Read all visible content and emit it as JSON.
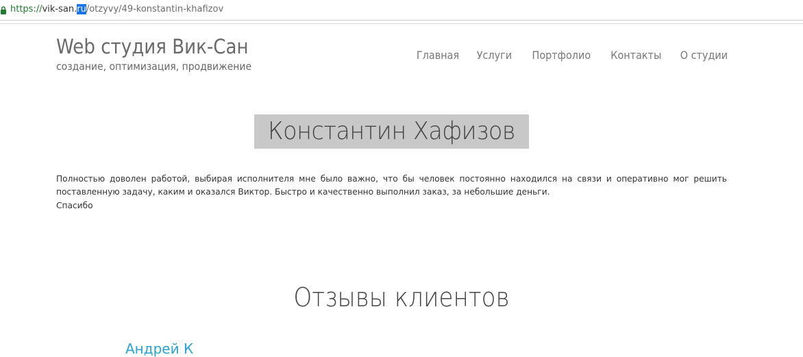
{
  "browser": {
    "url_protocol": "https://",
    "url_host_start": "vik-san.",
    "url_host_selected": "ru",
    "url_path": "/otzyvy/49-konstantin-khafizov"
  },
  "site": {
    "brand_title": "Web студия Вик-Сан",
    "brand_subtitle": "создание, оптимизация, продвижение"
  },
  "nav": {
    "items": [
      {
        "label": "Главная"
      },
      {
        "label": "Услуги"
      },
      {
        "label": "Портфолио"
      },
      {
        "label": "Контакты"
      },
      {
        "label": "О студии"
      }
    ]
  },
  "review": {
    "author": "Константин Хафизов",
    "text": "Полностью доволен работой, выбирая исполнителя мне было важно, что бы человек постоянно находился на связи и оперативно мог решить поставленную задачу, каким и оказался Виктор. Быстро и качественно выполнил заказ, за небольшие деньги.",
    "closing": "Спасибо"
  },
  "reviews_section": {
    "title": "Отзывы клиентов",
    "next_author_partial": "Андрей К"
  },
  "colors": {
    "link_blue": "#29a3d6",
    "selection_highlight": "#c8c8c8",
    "url_selection": "#1a73e8",
    "lock_green": "#1e7c2d"
  },
  "icons": {
    "lock": "lock-icon"
  }
}
